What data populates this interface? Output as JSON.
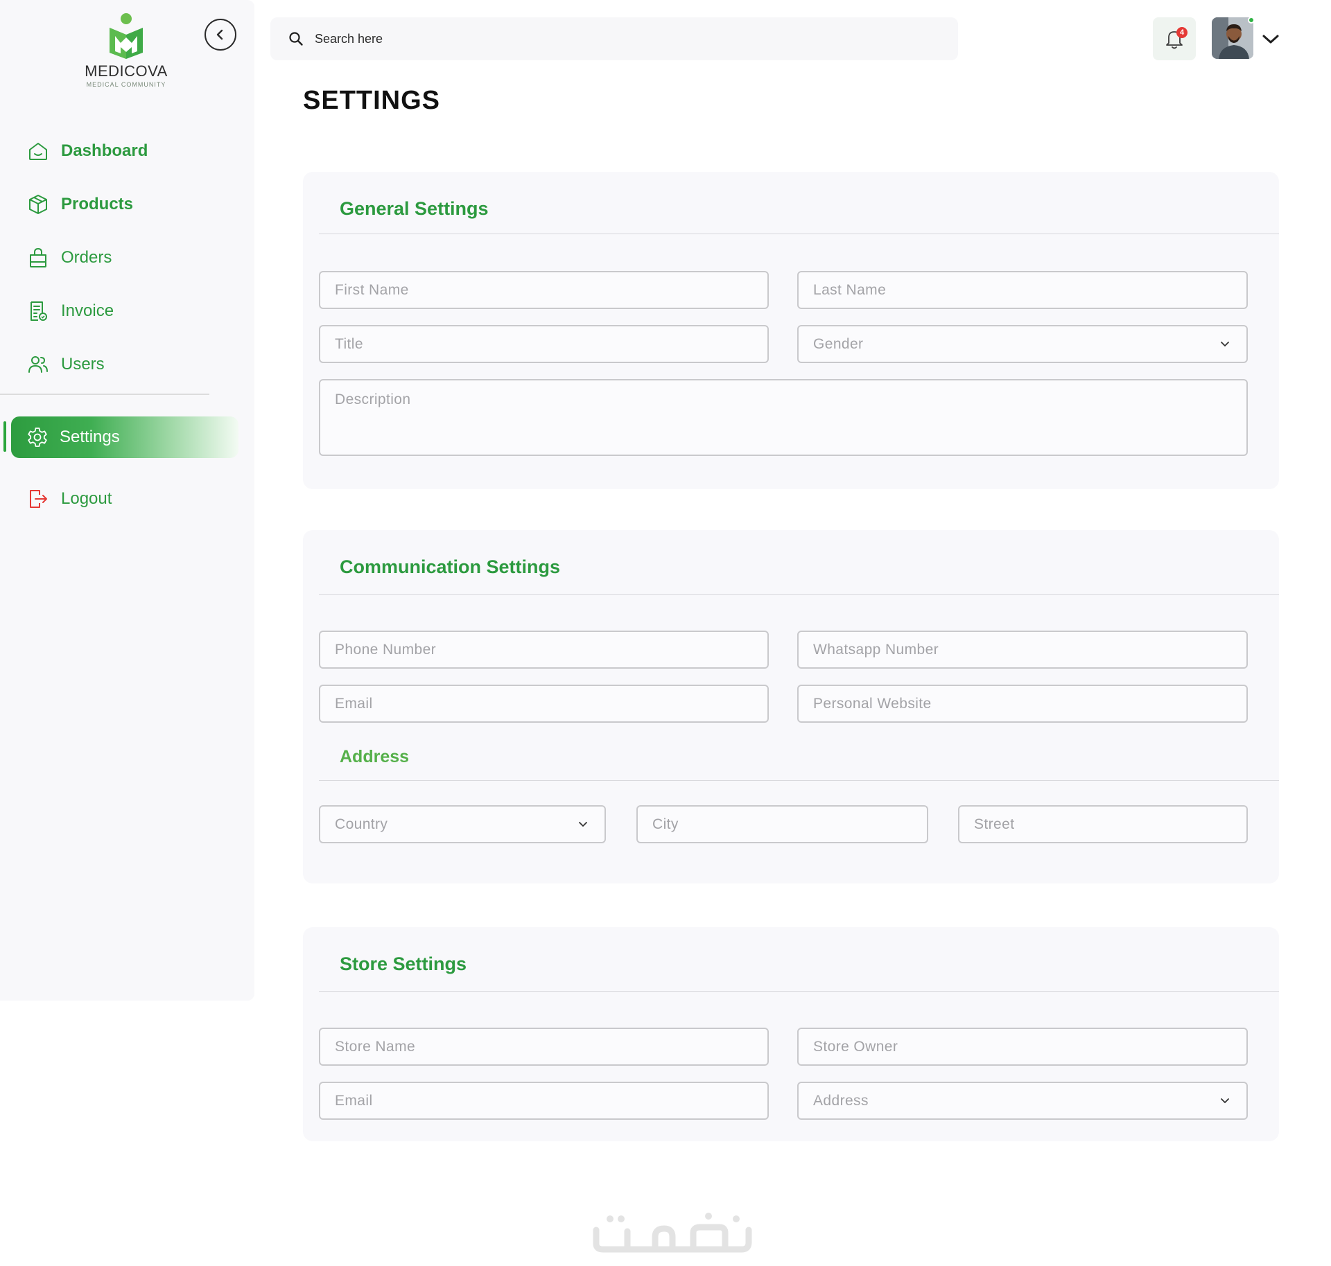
{
  "brand": {
    "name": "MEDICOVA",
    "tagline": "MEDICAL COMMUNITY"
  },
  "sidebar": {
    "items": [
      {
        "label": "Dashboard",
        "icon": "home-icon"
      },
      {
        "label": "Products",
        "icon": "box-icon"
      },
      {
        "label": "Orders",
        "icon": "shopping-bag-icon"
      },
      {
        "label": "Invoice",
        "icon": "invoice-icon"
      },
      {
        "label": "Users",
        "icon": "users-icon"
      }
    ],
    "active": {
      "label": "Settings",
      "icon": "gear-icon"
    },
    "logout": {
      "label": "Logout",
      "icon": "logout-icon"
    }
  },
  "topbar": {
    "search_placeholder": "Search here",
    "notification_count": "4"
  },
  "page": {
    "title": "SETTINGS"
  },
  "general": {
    "title": "General Settings",
    "first_name": "First Name",
    "last_name": "Last Name",
    "title_field": "Title",
    "gender": "Gender",
    "description": "Description"
  },
  "communication": {
    "title": "Communication Settings",
    "phone": "Phone Number",
    "whatsapp": "Whatsapp Number",
    "email": "Email",
    "website": "Personal Website",
    "address_title": "Address",
    "country": "Country",
    "city": "City",
    "street": "Street"
  },
  "store": {
    "title": "Store Settings",
    "store_name": "Store Name",
    "store_owner": "Store Owner",
    "email": "Email",
    "address": "Address"
  },
  "colors": {
    "accent": "#2c9a3f",
    "logout": "#e53935",
    "badge": "#e53935",
    "online": "#2fb344"
  }
}
